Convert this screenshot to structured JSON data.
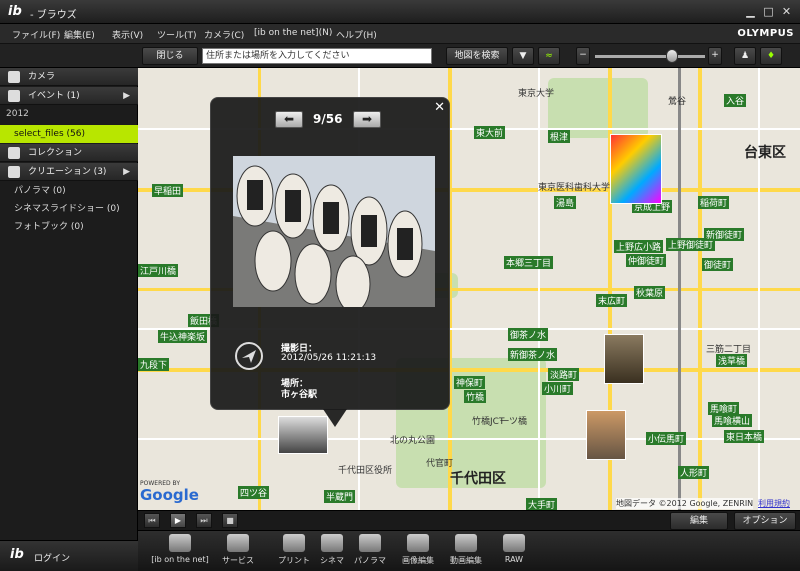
{
  "app": {
    "logo": "ib",
    "title": "- ブラウズ"
  },
  "menu": [
    "ファイル(F)",
    "編集(E)",
    "表示(V)",
    "ツール(T)",
    "カメラ(C)",
    "[ib on the net](N)",
    "ヘルプ(H)"
  ],
  "brand": "OLYMPUS",
  "toolbar": {
    "close_label": "閉じる",
    "search_placeholder": "住所または場所を入力してください",
    "search_button": "地図を検索",
    "zoom_minus": "−",
    "zoom_plus": "+",
    "zoom_level": 0.7
  },
  "sidebar": {
    "camera": "カメラ",
    "events": "イベント (1)",
    "year": "2012",
    "selected_event": "select_files (56)",
    "collection": "コレクション",
    "creation": "クリエーション (3)",
    "panorama": "パノラマ (0)",
    "slideshow": "シネマスライドショー (0)",
    "photobook": "フォトブック (0)",
    "login": "ログイン"
  },
  "popup": {
    "counter": "9/56",
    "date_label": "撮影日：",
    "date_value": "2012/05/26 11:21:13",
    "place_label": "場所：",
    "place_value": "市ヶ谷駅"
  },
  "map": {
    "ward_chiyoda": "千代田区",
    "ward_taito": "台東区",
    "stations": [
      "東大前",
      "根津",
      "湯島",
      "上野広小路",
      "仲御徒町",
      "上野御徒町",
      "御徒町",
      "新御徒町",
      "末広町",
      "秋葉原",
      "神保町",
      "小川町",
      "淡路町",
      "新御茶ノ水",
      "御茶ノ水",
      "本郷三丁目",
      "浅草橋",
      "馬喰町",
      "馬喰横山",
      "東日本橋",
      "小伝馬町",
      "人形町",
      "大手町",
      "竹橋",
      "九段下",
      "飯田橋",
      "牛込神楽坂",
      "早稲田",
      "江戸川橋",
      "四ツ谷",
      "半蔵門",
      "稲荷町",
      "入谷",
      "京成上野",
      "新御徒町"
    ],
    "labels": [
      "東京大学",
      "千代田区役所",
      "東京医科歯科大学",
      "北の丸公園",
      "代官町",
      "一ツ橋",
      "竹橋JCT",
      "鶯谷",
      "三筋二丁目"
    ],
    "copyright": "地図データ ©2012 Google, ZENRIN",
    "terms": "利用規約",
    "google": "Google",
    "powered": "POWERED BY"
  },
  "bottom": {
    "ib_net": "[ib on the net]",
    "service": "サービス",
    "print": "プリント",
    "cinema": "シネマ",
    "panorama": "パノラマ",
    "image_edit": "画像編集",
    "video_edit": "動画編集",
    "raw": "RAW",
    "edit": "編集",
    "option": "オプション"
  }
}
